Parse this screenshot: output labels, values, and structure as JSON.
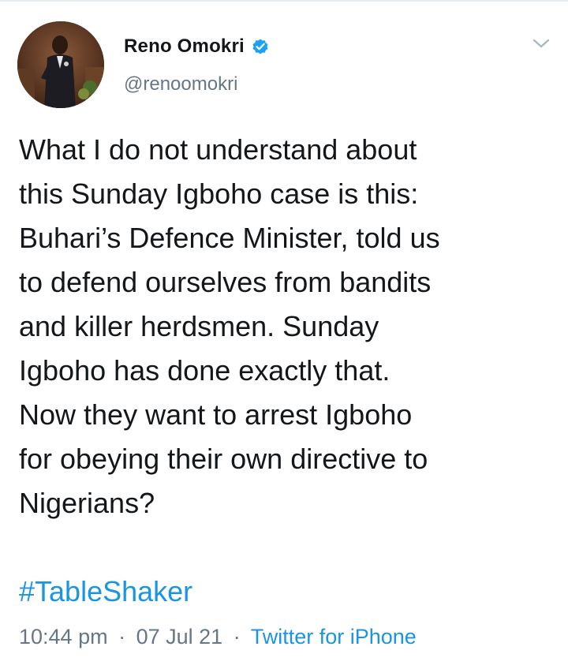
{
  "author": {
    "display_name": "Reno Omokri",
    "handle": "@renoomokri",
    "verified": true
  },
  "icons": {
    "verified": "verified-badge-icon",
    "menu": "chevron-down-icon"
  },
  "tweet": {
    "text": "What I do not understand about\nthis Sunday Igboho case is this:\nBuhari’s Defence Minister, told us\nto defend ourselves from bandits\nand killer herdsmen. Sunday\nIgboho has done exactly that.\nNow they want to arrest Igboho\nfor obeying their own directive to\nNigerians?",
    "hashtag": "#TableShaker"
  },
  "meta": {
    "time": "10:44 pm",
    "separator": "·",
    "date": "07 Jul 21",
    "source": "Twitter for iPhone"
  },
  "colors": {
    "link": "#1b95e0",
    "verified": "#1da1f2",
    "secondary_text": "#657786",
    "primary_text": "#14171a"
  }
}
